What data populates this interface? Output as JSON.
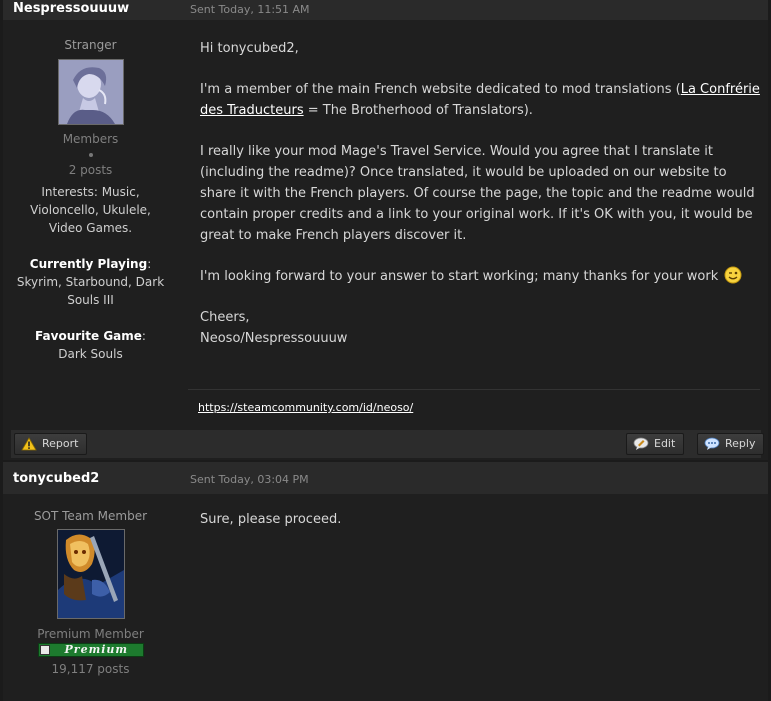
{
  "posts": [
    {
      "author": "Nespressouuuw",
      "date": "Sent Today, 11:51 AM",
      "member_title": "Stranger",
      "group": "Members",
      "post_count": "2 posts",
      "interests": [
        "Interests: Music,",
        "Violoncello, Ukulele,",
        "Video Games."
      ],
      "playing_label": "Currently Playing",
      "playing_lines": [
        "Skyrim, Starbound, Dark",
        "Souls III"
      ],
      "fav_label": "Favourite Game",
      "fav_value": "Dark Souls",
      "body": {
        "greeting": "Hi tonycubed2,",
        "p1_before": "I'm a member of the main French website dedicated to mod translations (",
        "p1_link": "La Confrérie des Traducteurs",
        "p1_after": " = The Brotherhood of Translators).",
        "p2": "I really like your mod Mage's Travel Service. Would you agree that I translate it (including the readme)? Once translated, it would be uploaded on our website to share it with the French players. Of course the page, the topic and the readme would contain proper credits and a link to your original work. If it's OK with you, it would be great to make French players discover it.",
        "p3": "I'm looking forward to your answer to start working; many thanks for your work",
        "closing": "Cheers,",
        "signoff": "Neoso/Nespressouuuw"
      },
      "signature_link": "https://steamcommunity.com/id/neoso/"
    },
    {
      "author": "tonycubed2",
      "date": "Sent Today, 03:04 PM",
      "member_title": "SOT Team Member",
      "group": "Premium Member",
      "badge": "Premium",
      "post_count": "19,117 posts",
      "body_text": "Sure, please proceed."
    }
  ],
  "controls": {
    "report": "Report",
    "edit": "Edit",
    "reply": "Reply"
  },
  "icons": {
    "report": "warning-icon",
    "edit": "edit-bubble-icon",
    "reply": "reply-bubble-icon",
    "smiley": "wink-smiley-icon"
  },
  "colors": {
    "background": "#1b1b1b",
    "header": "#2a2a2a",
    "badge_green": "#1d7a2e"
  }
}
